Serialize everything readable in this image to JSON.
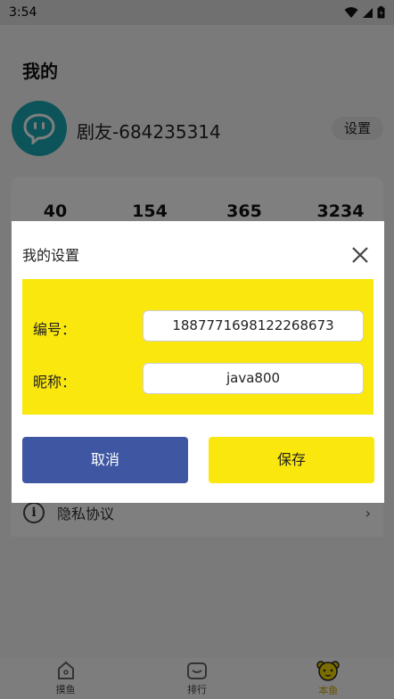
{
  "status_bar": {
    "time": "3:54"
  },
  "profile": {
    "page_title": "我的",
    "nickname": "剧友-684235314",
    "settings_label": "设置"
  },
  "stats": [
    "40",
    "154",
    "365",
    "3234"
  ],
  "menu": {
    "privacy_label": "隐私协议"
  },
  "bottom_nav": [
    {
      "label": "摸鱼",
      "icon": "home-icon"
    },
    {
      "label": "排行",
      "icon": "ranking-icon"
    },
    {
      "label": "本鱼",
      "icon": "bear-icon",
      "active": true
    }
  ],
  "dialog": {
    "title": "我的设置",
    "id_label": "编号：",
    "id_value": "1887771698122268673",
    "name_label": "昵称：",
    "name_value": "java800",
    "cancel_label": "取消",
    "save_label": "保存"
  },
  "colors": {
    "accent_yellow": "#fae70d",
    "cancel_blue": "#3f57a3",
    "avatar_teal": "#1aa7b5"
  }
}
